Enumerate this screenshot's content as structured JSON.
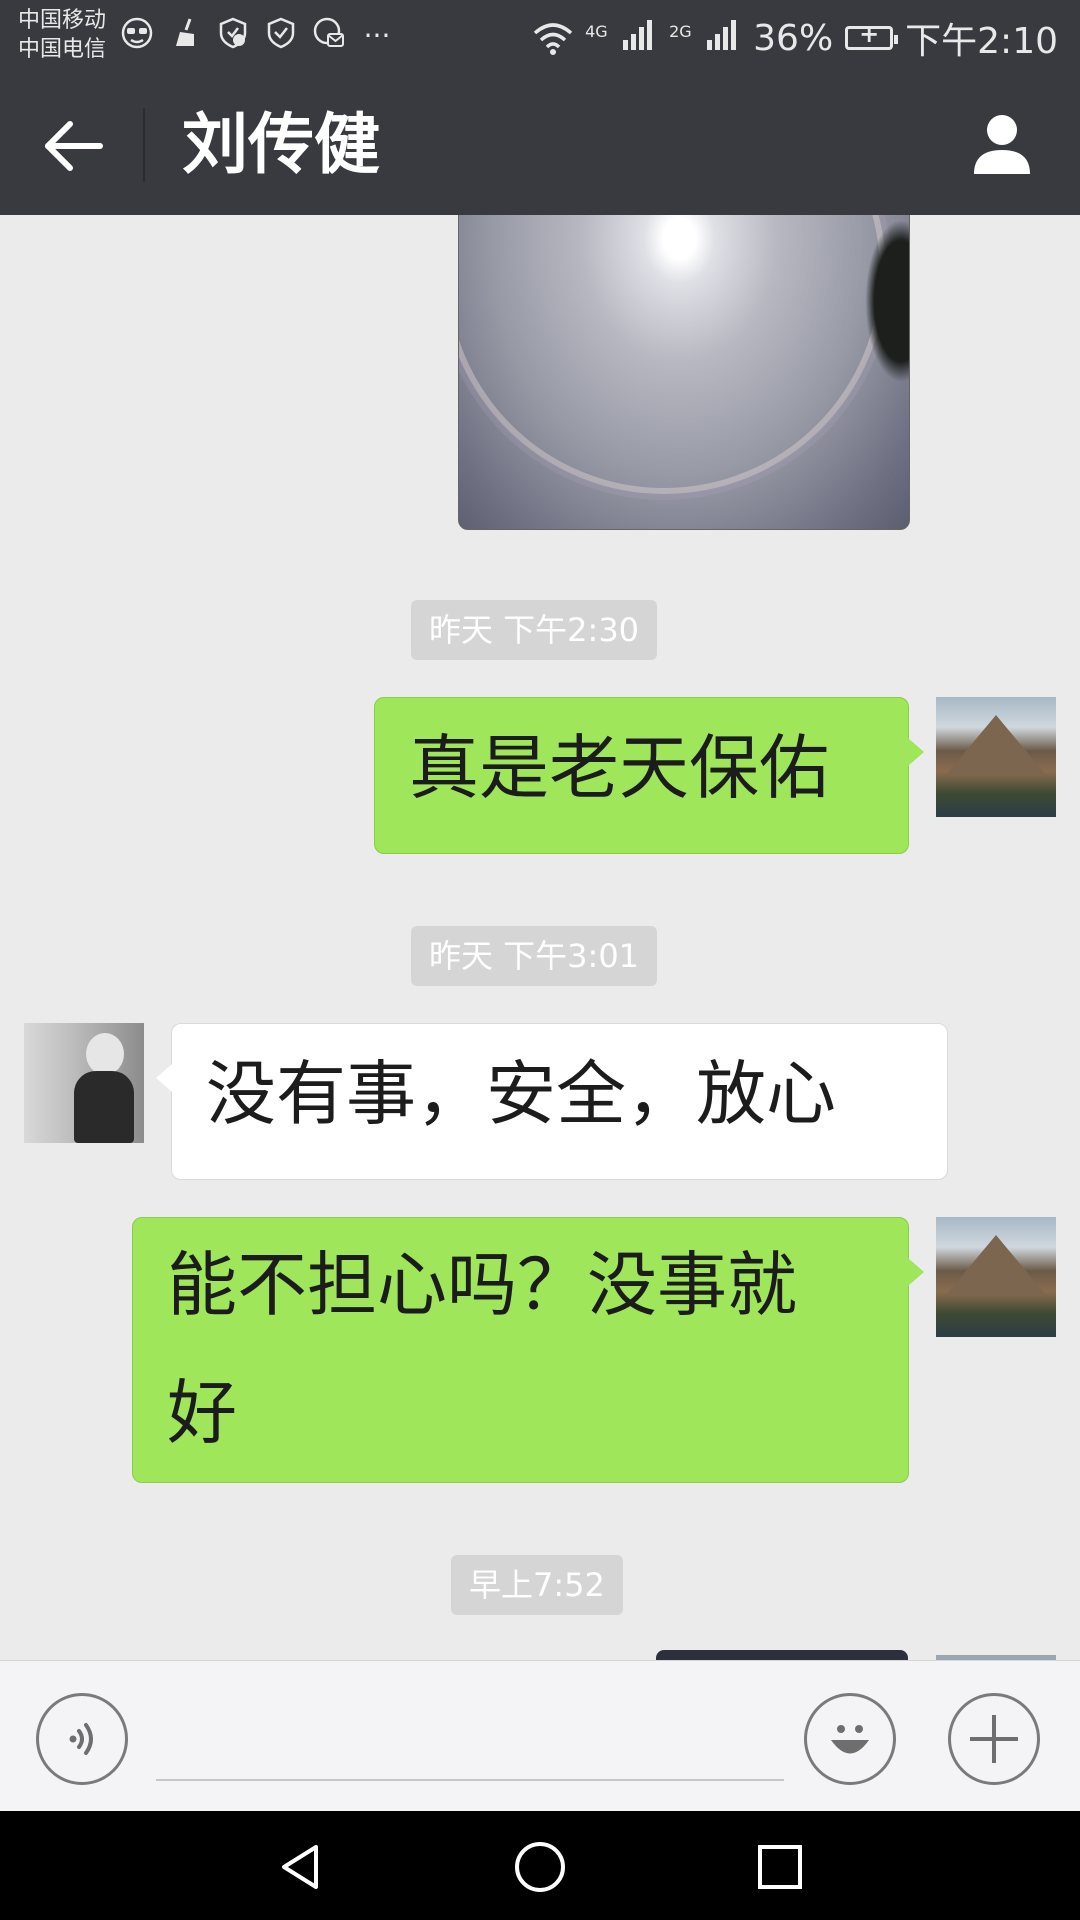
{
  "status_bar": {
    "carrier_1": "中国移动",
    "carrier_2": "中国电信",
    "notification_icons": [
      "glasses-icon",
      "broom-icon",
      "shield-check-icon",
      "shield-icon",
      "chat-settings-icon"
    ],
    "more_indicator": "···",
    "network_1": "4G",
    "network_2": "2G",
    "battery": "36%",
    "time": "下午2:10"
  },
  "title_bar": {
    "title": "刘传健"
  },
  "messages": [
    {
      "type": "image",
      "from": "me"
    },
    {
      "type": "timestamp",
      "text": "昨天 下午2:30"
    },
    {
      "type": "text",
      "from": "me",
      "text": "真是老天保佑"
    },
    {
      "type": "timestamp",
      "text": "昨天 下午3:01"
    },
    {
      "type": "text",
      "from": "them",
      "text": "没有事，安全，放心"
    },
    {
      "type": "text",
      "from": "me",
      "text_line1": "能不担心吗？没事就",
      "text_line2": "好"
    },
    {
      "type": "timestamp",
      "text": "早上7:52"
    }
  ],
  "colors": {
    "header_bg": "#393a3f",
    "chat_bg": "#ebebeb",
    "my_bubble": "#9fe65a",
    "their_bubble": "#ffffff",
    "timestamp_bg": "#d5d5d5"
  },
  "input_bar": {
    "voice_icon": "voice-icon",
    "emoji_icon": "emoji-icon",
    "plus_icon": "plus-icon",
    "field_value": ""
  },
  "nav_bar": {
    "buttons": [
      "back-triangle-icon",
      "home-circle-icon",
      "recents-square-icon"
    ]
  }
}
